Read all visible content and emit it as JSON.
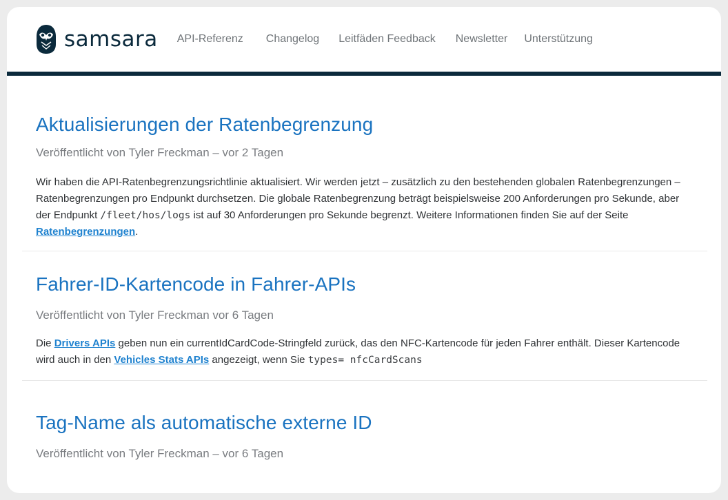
{
  "brand": {
    "name": "samsara",
    "colors": {
      "primary_dark": "#0b2a3c",
      "heading_blue": "#1a73c0",
      "link_blue": "#1f82cf"
    }
  },
  "nav": {
    "items": [
      {
        "label": "API-Referenz"
      },
      {
        "label": "Changelog"
      },
      {
        "label": "Leitfäden Feedback"
      },
      {
        "label": "Newsletter"
      },
      {
        "label": "Unterstützung"
      }
    ]
  },
  "posts": [
    {
      "title": "Aktualisierungen der Ratenbegrenzung",
      "meta": "Veröffentlicht von Tyler Freckman – vor 2 Tagen",
      "body": {
        "text1": "Wir haben die API-Ratenbegrenzungsrichtlinie aktualisiert. Wir werden jetzt – zusätzlich zu den bestehenden globalen Ratenbegrenzungen – Ratenbegrenzungen pro Endpunkt durchsetzen. Die globale Ratenbegrenzung beträgt beispielsweise 200 Anforderungen pro Sekunde, aber der Endpunkt ",
        "code1": "/fleet/hos/logs",
        "text2": " ist auf 30 Anforderungen pro Sekunde begrenzt. Weitere Informationen finden Sie auf der Seite ",
        "link1": "Ratenbegrenzungen",
        "text3": "."
      }
    },
    {
      "title": "Fahrer-ID-Kartencode in Fahrer-APIs",
      "meta": "Veröffentlicht von Tyler Freckman vor 6 Tagen",
      "body": {
        "text1": "Die ",
        "link1": "Drivers APIs",
        "text2": " geben nun ein currentIdCardCode-Stringfeld zurück, das den NFC-Kartencode für jeden Fahrer enthält. Dieser Kartencode wird auch in den ",
        "link2": "Vehicles Stats APIs",
        "text3": " angezeigt, wenn Sie ",
        "code1": "types= nfcCardScans"
      }
    },
    {
      "title": "Tag-Name als automatische externe ID",
      "meta": "Veröffentlicht von Tyler Freckman – vor 6 Tagen"
    }
  ]
}
